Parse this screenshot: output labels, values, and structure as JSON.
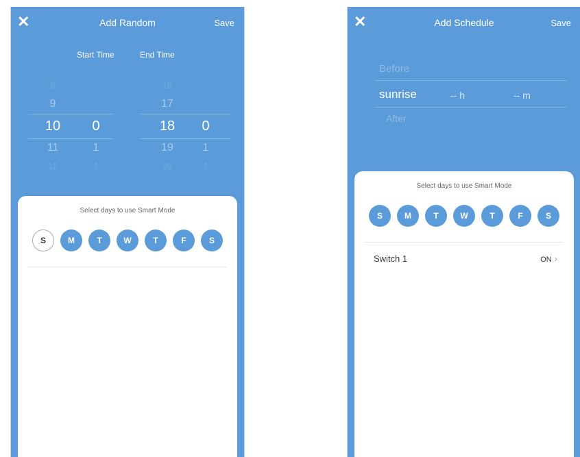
{
  "left": {
    "close_icon": "✕",
    "title": "Add Random",
    "save_label": "Save",
    "start_label": "Start Time",
    "end_label": "End Time",
    "start_hour": [
      "8",
      "9",
      "10",
      "11",
      "12"
    ],
    "start_minute": [
      "0",
      "1",
      "2"
    ],
    "end_hour": [
      "16",
      "17",
      "18",
      "19",
      "20"
    ],
    "end_minute": [
      "0",
      "1",
      "2"
    ],
    "sheet_title": "Select days to use Smart Mode",
    "days": [
      "S",
      "M",
      "T",
      "W",
      "T",
      "F",
      "S"
    ]
  },
  "right": {
    "close_icon": "✕",
    "title": "Add Schedule",
    "save_label": "Save",
    "before": "Before",
    "sunrise": "sunrise",
    "hours": "-- h",
    "minutes": "-- m",
    "after": "After",
    "sheet_title": "Select days to use Smart Mode",
    "days": [
      "S",
      "M",
      "T",
      "W",
      "T",
      "F",
      "S"
    ],
    "switch_label": "Switch 1",
    "switch_value": "ON",
    "chevron": "›"
  },
  "colors": {
    "accent": "#5b9bd9"
  }
}
